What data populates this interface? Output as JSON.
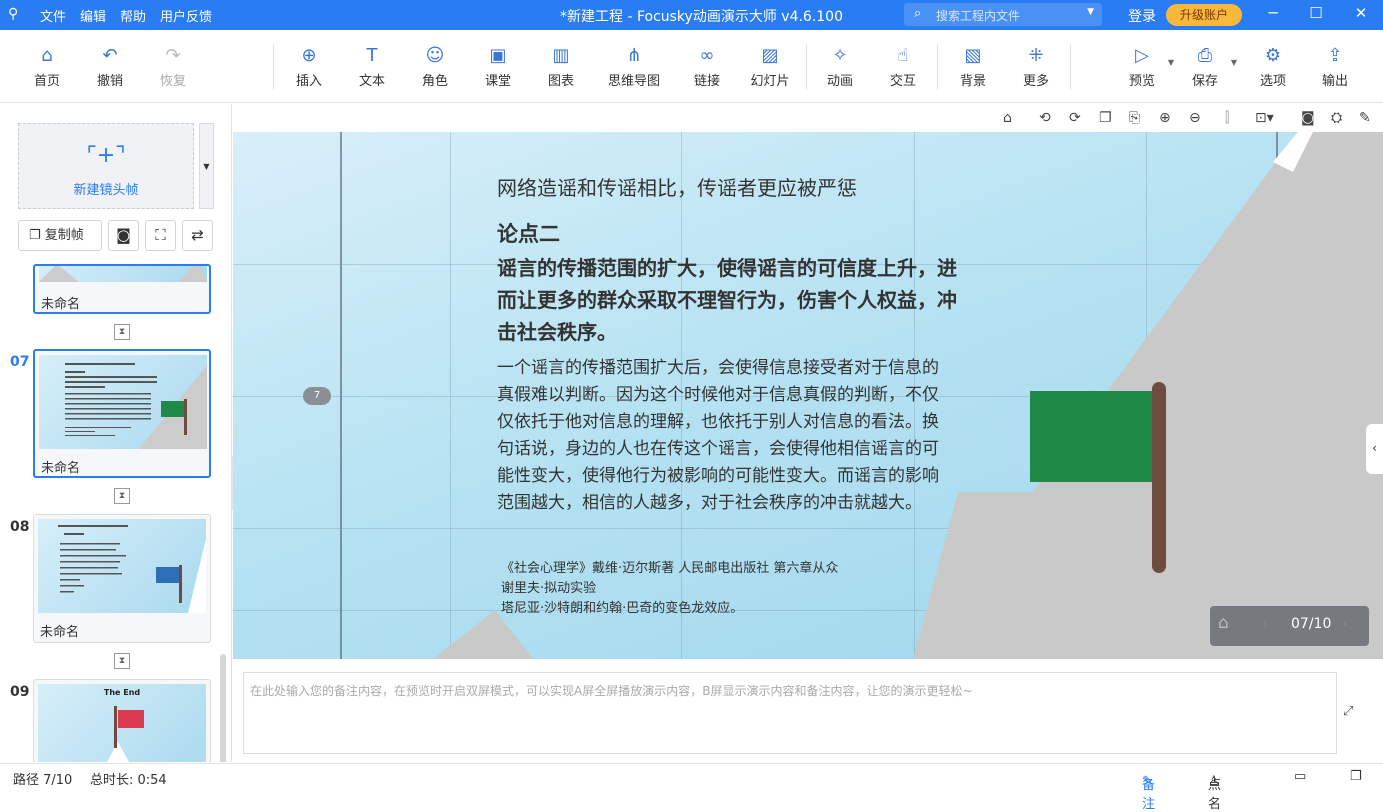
{
  "app": {
    "title": "*新建工程 - Focusky动画演示大师  v4.6.100",
    "menu": [
      "文件",
      "编辑",
      "帮助",
      "用户反馈"
    ],
    "search_placeholder": "搜索工程内文件",
    "login": "登录",
    "upgrade": "升级账户"
  },
  "toolbar": {
    "home": "首页",
    "undo": "撤销",
    "redo": "恢复",
    "insert": "插入",
    "text": "文本",
    "role": "角色",
    "classroom": "课堂",
    "chart": "图表",
    "mindmap": "思维导图",
    "link": "链接",
    "slide": "幻灯片",
    "animation": "动画",
    "interact": "交互",
    "background": "背景",
    "more": "更多",
    "preview": "预览",
    "save": "保存",
    "options": "选项",
    "export": "输出"
  },
  "leftpanel": {
    "new_frame": "新建镜头帧",
    "copy_frame": "复制帧",
    "thumbnails": [
      {
        "num": "",
        "name": "未命名"
      },
      {
        "num": "07",
        "name": "未命名"
      },
      {
        "num": "08",
        "name": "未命名"
      },
      {
        "num": "09",
        "name": ""
      }
    ],
    "thumb9_title": "The End"
  },
  "slide": {
    "heading": "网络造谣和传谣相比，传谣者更应被严惩",
    "point_title": "论点二",
    "point_line1": "谣言的传播范围的扩大，使得谣言的可信度上升，进",
    "point_line2": "而让更多的群众采取不理智行为，伤害个人权益，冲",
    "point_line3": "击社会秩序。",
    "body_lines": [
      "一个谣言的传播范围扩大后，会使得信息接受者对于信息的",
      "真假难以判断。因为这个时候他对于信息真假的判断，不仅",
      "仅依托于他对信息的理解，也依托于别人对信息的看法。换",
      "句话说，身边的人也在传这个谣言，会使得他相信谣言的可",
      "能性变大，使得他行为被影响的可能性变大。而谣言的影响",
      "范围越大，相信的人越多，对于社会秩序的冲击就越大。"
    ],
    "ref1": "《社会心理学》戴维·迈尔斯著 人民邮电出版社 第六章从众",
    "ref2": "谢里夫·拟动实验",
    "ref3": "塔尼亚·沙特朗和约翰·巴奇的变色龙效应。",
    "step_badge": "7",
    "nav_counter": "07/10"
  },
  "notes": {
    "placeholder": "在此处输入您的备注内容，在预览时开启双屏模式，可以实现A屏全屏播放演示内容，B屏显示演示内容和备注内容，让您的演示更轻松~"
  },
  "status": {
    "path": "路径 7/10",
    "duration": "总时长: 0:54",
    "notes": "备注",
    "rollcall": "点名"
  },
  "colors": {
    "accent": "#2a7cf2",
    "flag_green": "#1f8a47",
    "upgrade": "#f7b83b"
  }
}
